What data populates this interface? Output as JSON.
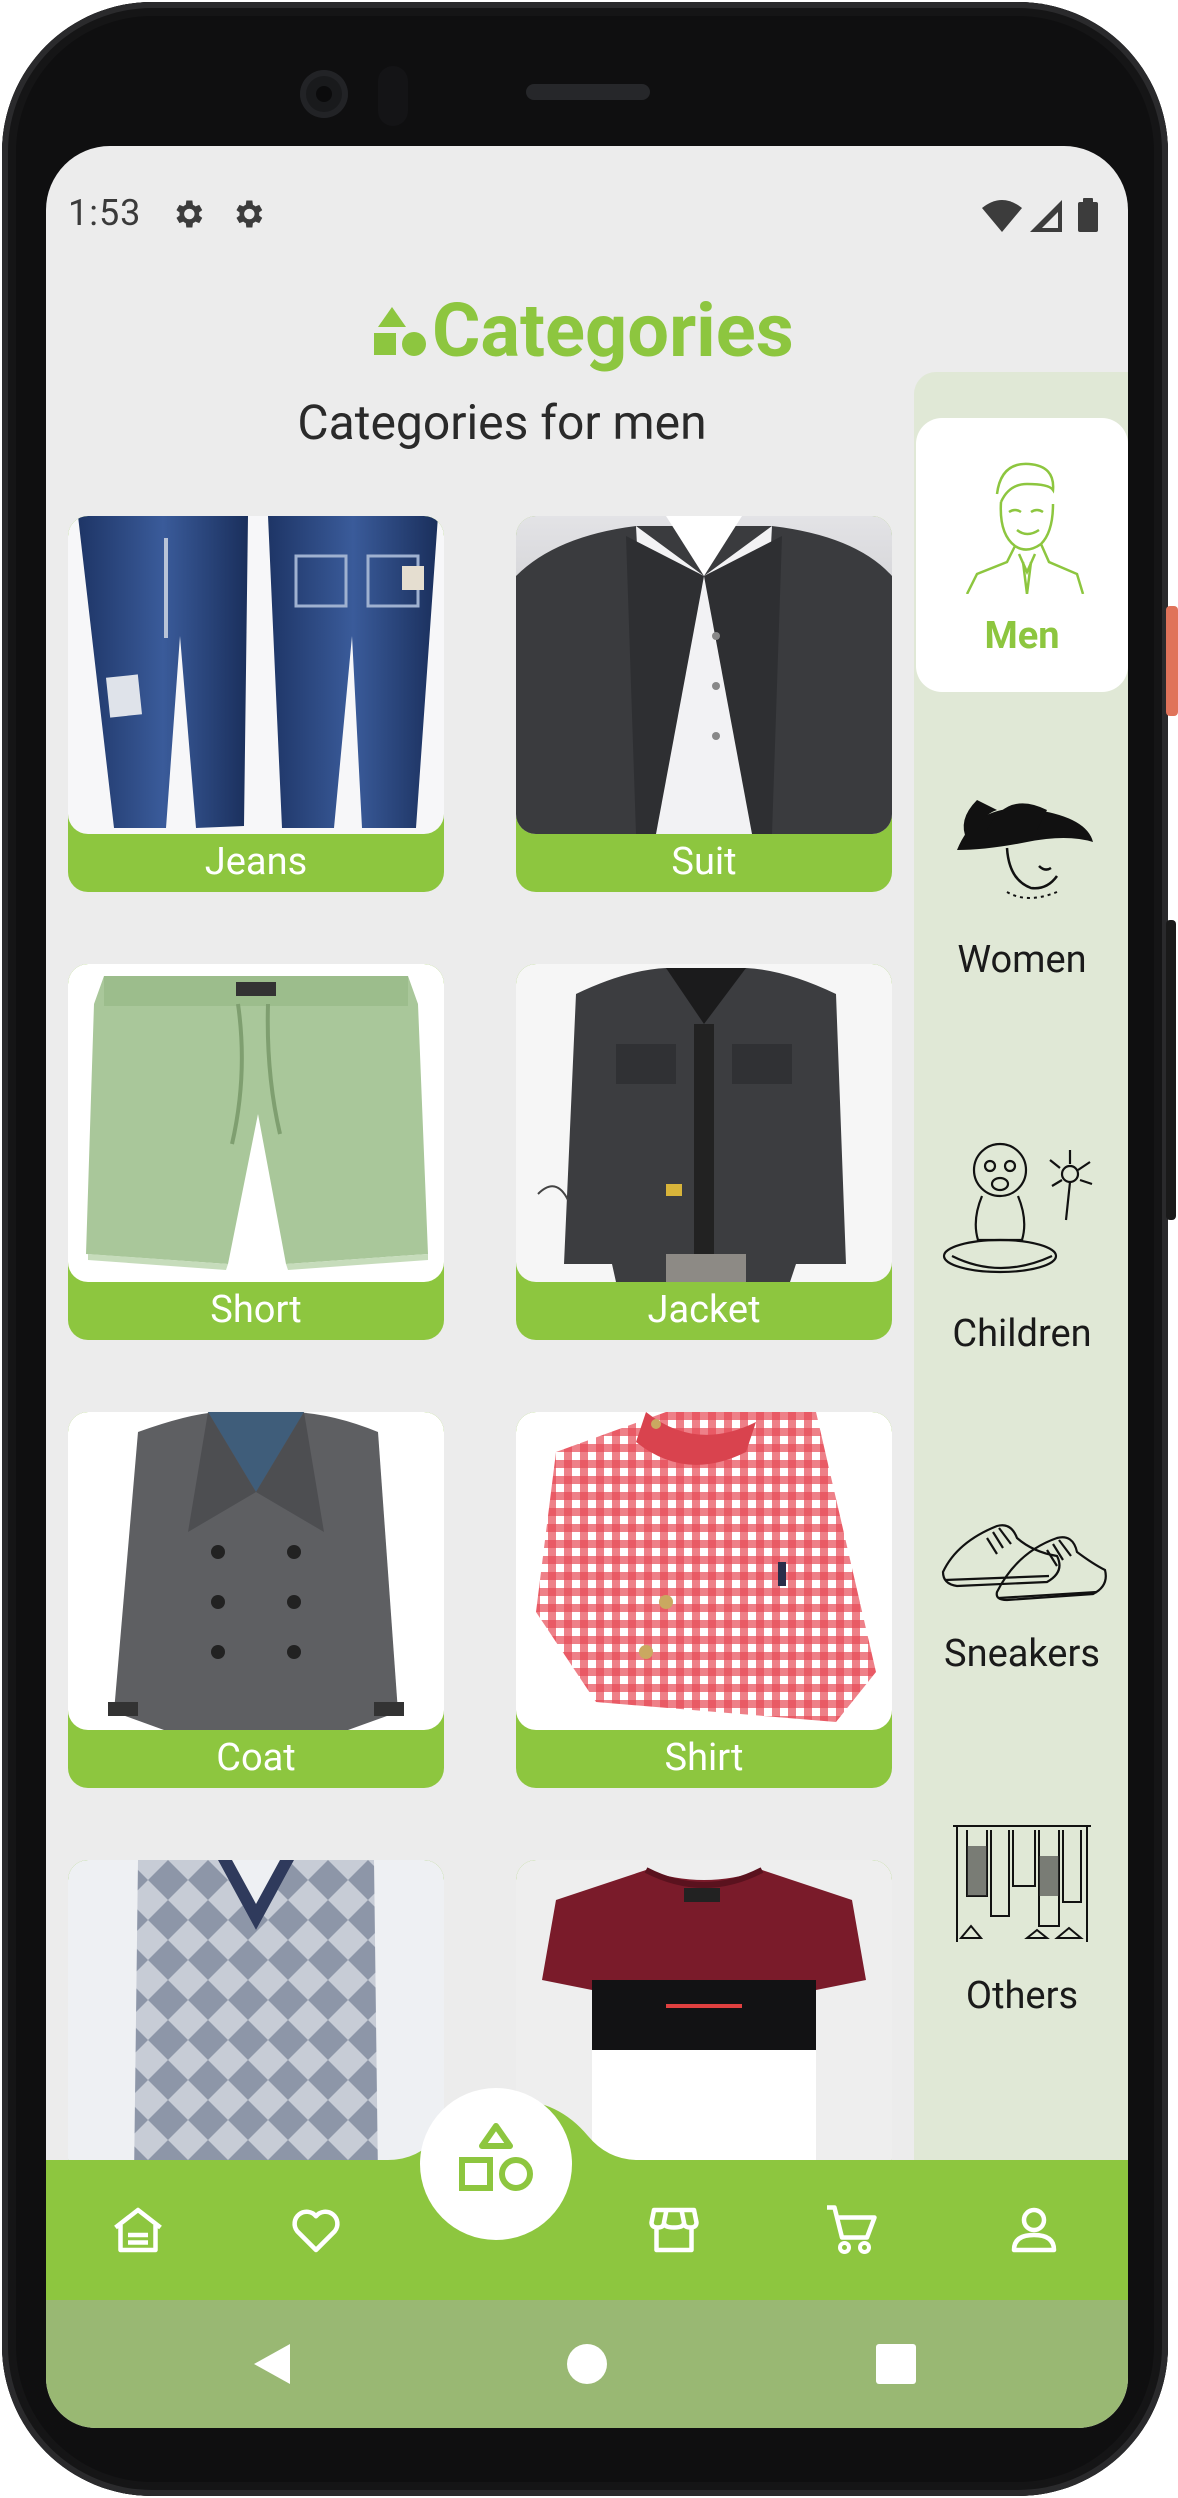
{
  "status_bar": {
    "time": "1:53",
    "left_icons": [
      "gear-icon",
      "gear-icon"
    ],
    "right_icons": [
      "wifi-icon",
      "signal-icon",
      "battery-icon"
    ]
  },
  "header": {
    "title": "Categories",
    "logo_icon": "shapes-icon",
    "subtitle": "Categories for men"
  },
  "products": [
    {
      "label": "Jeans"
    },
    {
      "label": "Suit"
    },
    {
      "label": "Short"
    },
    {
      "label": "Jacket"
    },
    {
      "label": "Coat"
    },
    {
      "label": "Shirt"
    },
    {
      "label": ""
    },
    {
      "label": ""
    }
  ],
  "sidebar": {
    "items": [
      {
        "label": "Men",
        "icon": "man-portrait-icon",
        "active": true
      },
      {
        "label": "Women",
        "icon": "woman-hat-icon",
        "active": false
      },
      {
        "label": "Children",
        "icon": "baby-icon",
        "active": false
      },
      {
        "label": "Sneakers",
        "icon": "sneakers-icon",
        "active": false
      },
      {
        "label": "Others",
        "icon": "clothing-rack-icon",
        "active": false
      }
    ]
  },
  "bottom_nav": {
    "items": [
      "home-icon",
      "heart-icon",
      "shapes-icon",
      "store-icon",
      "cart-icon",
      "profile-icon"
    ],
    "active": "shapes-icon"
  },
  "system_nav": [
    "back-icon",
    "home-circle-icon",
    "recents-icon"
  ],
  "colors": {
    "accent": "#8dc63f",
    "background": "#ececec",
    "sidebar": "#e0e8d6",
    "system_bar": "#99b873"
  }
}
